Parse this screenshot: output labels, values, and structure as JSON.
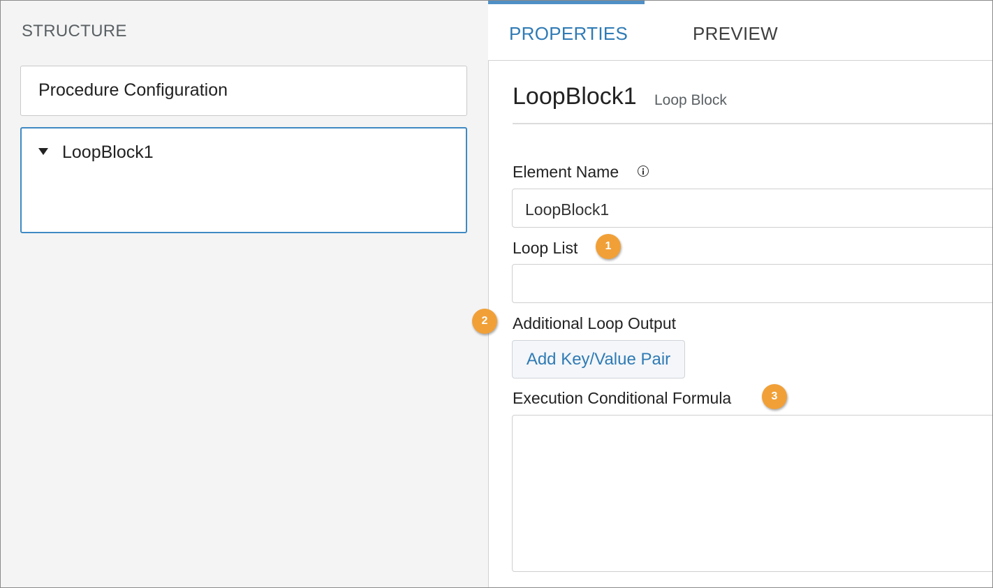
{
  "structure": {
    "header": "STRUCTURE",
    "items": [
      {
        "label": "Procedure Configuration"
      },
      {
        "label": "LoopBlock1"
      }
    ]
  },
  "tabs": [
    {
      "label": "PROPERTIES",
      "active": true
    },
    {
      "label": "PREVIEW",
      "active": false
    }
  ],
  "properties": {
    "title": "LoopBlock1",
    "subtitle": "Loop Block",
    "element_name_label": "Element Name",
    "element_name_value": "LoopBlock1",
    "loop_list_label": "Loop List",
    "loop_list_value": "",
    "additional_output_label": "Additional Loop Output",
    "add_pair_button": "Add Key/Value Pair",
    "formula_label": "Execution Conditional Formula",
    "formula_value": ""
  },
  "callouts": [
    "1",
    "2",
    "3"
  ],
  "colors": {
    "accent": "#2f7bb5",
    "selection_border": "#3f8ac4",
    "callout": "#f1a037"
  },
  "icons": {
    "info": "info-icon",
    "expand": "caret-down-icon"
  }
}
